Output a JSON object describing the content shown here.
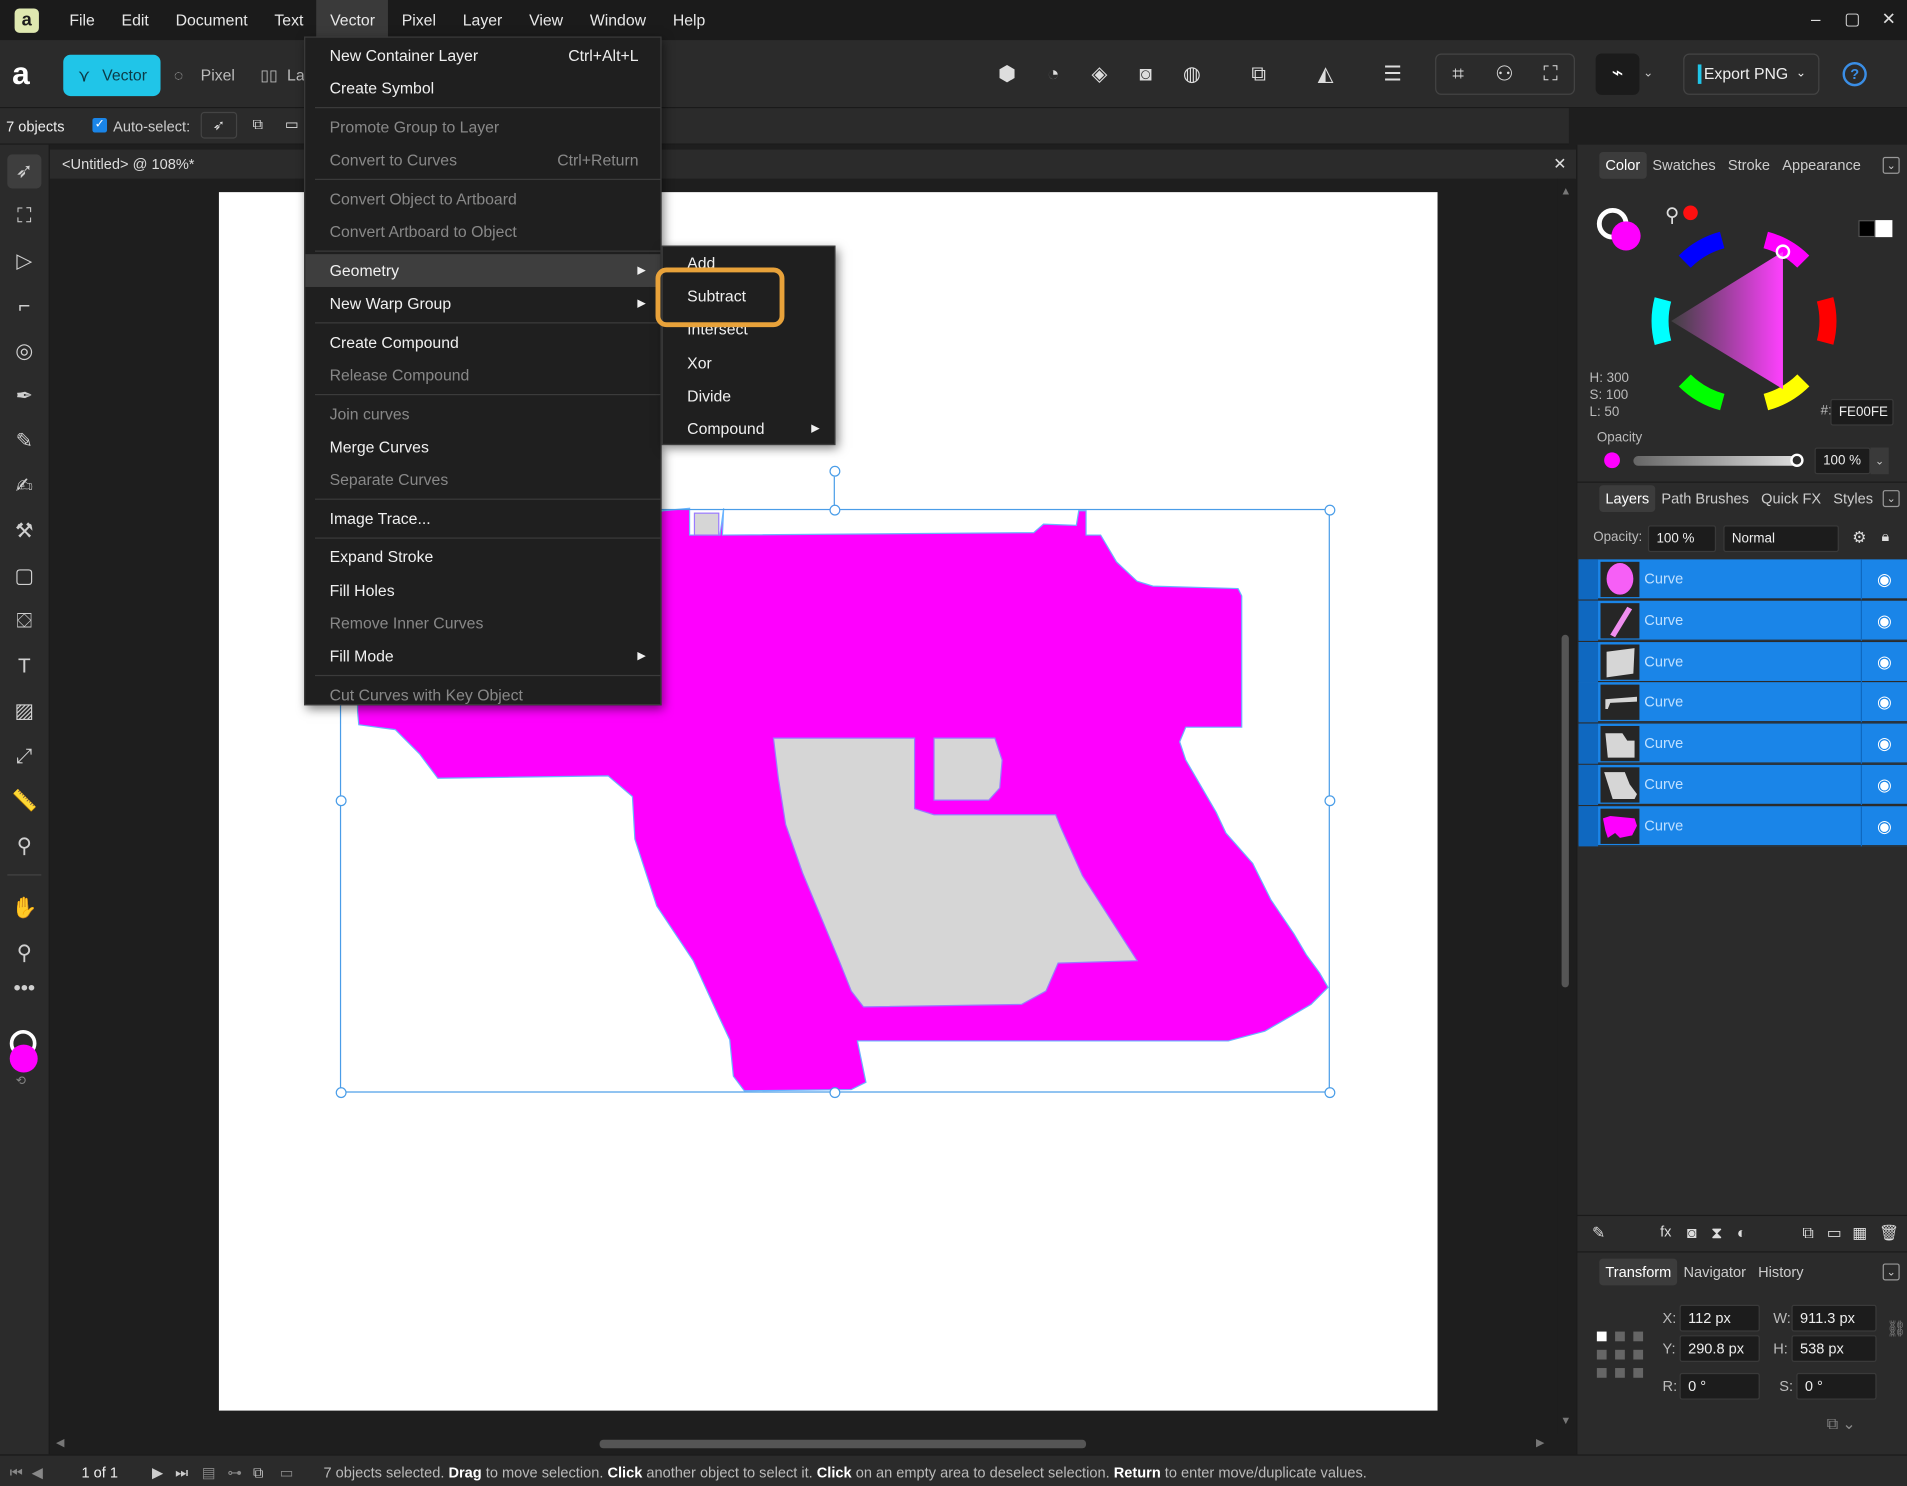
{
  "menubar": {
    "items": [
      "File",
      "Edit",
      "Document",
      "Text",
      "Vector",
      "Pixel",
      "Layer",
      "View",
      "Window",
      "Help"
    ],
    "active": "Vector",
    "window_controls": [
      "–",
      "▢",
      "✕"
    ]
  },
  "toolbar": {
    "personas": [
      "Vector",
      "Pixel",
      "Lay"
    ],
    "export_label": "Export PNG",
    "help": "?"
  },
  "context_bar": {
    "selection_count": "7 objects",
    "auto_select_label": "Auto-select:"
  },
  "document": {
    "tab_title": "<Untitled> @ 108%*"
  },
  "vector_menu": {
    "items": [
      {
        "label": "New Container Layer",
        "shortcut": "Ctrl+Alt+L",
        "disabled": false
      },
      {
        "label": "Create Symbol",
        "shortcut": "",
        "disabled": false
      },
      {
        "label": "Promote Group to Layer",
        "shortcut": "",
        "disabled": true
      },
      {
        "label": "Convert to Curves",
        "shortcut": "Ctrl+Return",
        "disabled": true
      },
      {
        "label": "Convert Object to Artboard",
        "shortcut": "",
        "disabled": true
      },
      {
        "label": "Convert Artboard to Object",
        "shortcut": "",
        "disabled": true
      },
      {
        "label": "Geometry",
        "shortcut": "",
        "disabled": false,
        "submenu": true,
        "highlighted": true
      },
      {
        "label": "New Warp Group",
        "shortcut": "",
        "disabled": false,
        "submenu": true
      },
      {
        "label": "Create Compound",
        "shortcut": "",
        "disabled": false
      },
      {
        "label": "Release Compound",
        "shortcut": "",
        "disabled": true
      },
      {
        "label": "Join curves",
        "shortcut": "",
        "disabled": true
      },
      {
        "label": "Merge Curves",
        "shortcut": "",
        "disabled": false
      },
      {
        "label": "Separate Curves",
        "shortcut": "",
        "disabled": true
      },
      {
        "label": "Image Trace...",
        "shortcut": "",
        "disabled": false
      },
      {
        "label": "Expand Stroke",
        "shortcut": "",
        "disabled": false
      },
      {
        "label": "Fill Holes",
        "shortcut": "",
        "disabled": false
      },
      {
        "label": "Remove Inner Curves",
        "shortcut": "",
        "disabled": true
      },
      {
        "label": "Fill Mode",
        "shortcut": "",
        "disabled": false,
        "submenu": true
      },
      {
        "label": "Cut Curves with Key Object",
        "shortcut": "",
        "disabled": true
      }
    ]
  },
  "geometry_submenu": {
    "items": [
      "Add",
      "Subtract",
      "Intersect",
      "Xor",
      "Divide",
      "Compound"
    ],
    "highlighted": "Subtract"
  },
  "color_panel": {
    "tabs": [
      "Color",
      "Swatches",
      "Stroke",
      "Appearance"
    ],
    "h": "H: 300",
    "s": "S: 100",
    "l": "L: 50",
    "hex_label": "#:",
    "hex": "FE00FE",
    "opacity_label": "Opacity",
    "opacity": "100 %",
    "fill_color": "#fe00fe"
  },
  "layers_panel": {
    "tabs": [
      "Layers",
      "Path Brushes",
      "Quick FX",
      "Styles"
    ],
    "opacity_label": "Opacity:",
    "opacity": "100 %",
    "blend_mode": "Normal",
    "layers": [
      {
        "name": "Curve"
      },
      {
        "name": "Curve"
      },
      {
        "name": "Curve"
      },
      {
        "name": "Curve"
      },
      {
        "name": "Curve"
      },
      {
        "name": "Curve"
      },
      {
        "name": "Curve"
      }
    ]
  },
  "transform_panel": {
    "tabs": [
      "Transform",
      "Navigator",
      "History"
    ],
    "x_label": "X:",
    "x": "112 px",
    "y_label": "Y:",
    "y": "290.8 px",
    "w_label": "W:",
    "w": "911.3 px",
    "h_label": "H:",
    "h": "538 px",
    "r_label": "R:",
    "r": "0 °",
    "s_label": "S:",
    "s": "0 °"
  },
  "status": {
    "page": "1 of 1",
    "message_parts": [
      {
        "t": "7 objects selected. ",
        "b": false
      },
      {
        "t": "Drag",
        "b": true
      },
      {
        "t": " to move selection. ",
        "b": false
      },
      {
        "t": "Click",
        "b": true
      },
      {
        "t": " another object to select it. ",
        "b": false
      },
      {
        "t": "Click",
        "b": true
      },
      {
        "t": " on an empty area to deselect selection. ",
        "b": false
      },
      {
        "t": "Return",
        "b": true
      },
      {
        "t": " to enter move/duplicate values.",
        "b": false
      }
    ]
  }
}
